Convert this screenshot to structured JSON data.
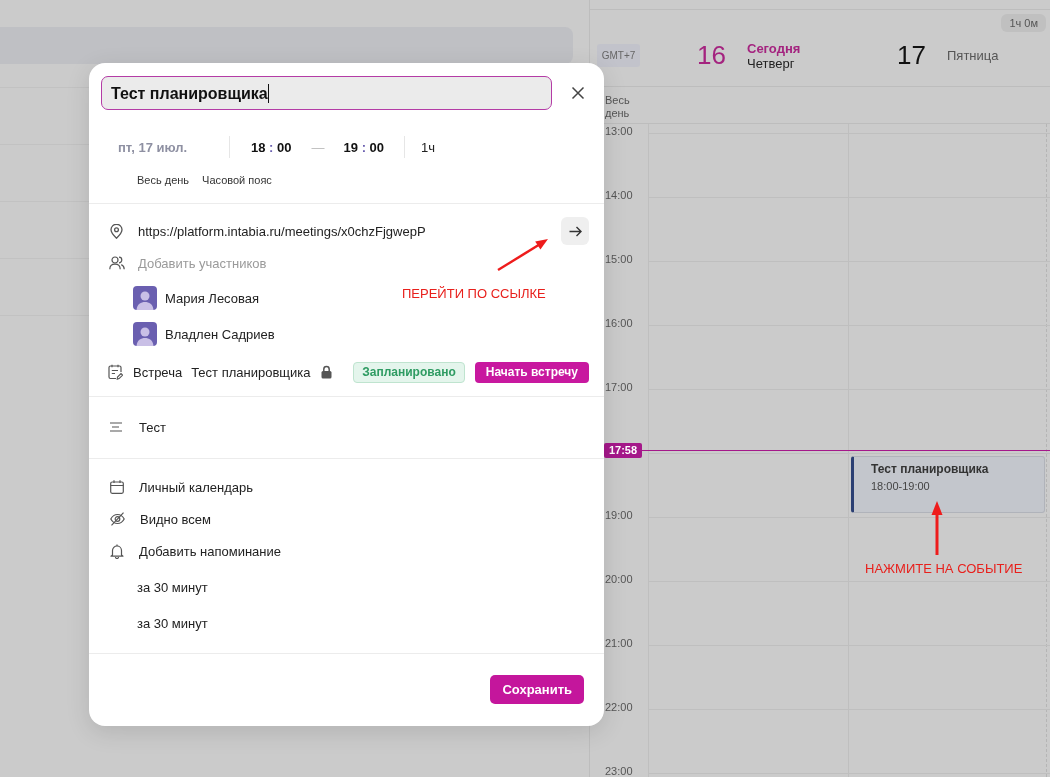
{
  "calendar": {
    "duration_badge": "1ч 0м",
    "timezone": "GMT+7",
    "days": [
      {
        "number": "16",
        "today": true,
        "today_label": "Сегодня",
        "weekday": "Четверг"
      },
      {
        "number": "17",
        "today": false,
        "weekday": "Пятница",
        "events": [
          {
            "title": "Тест планировщика",
            "time": "18:00-19:00"
          }
        ]
      }
    ],
    "all_day_label": "Весь день",
    "hours": [
      {
        "kind": "hour",
        "label": "13:00"
      },
      {
        "kind": "hour",
        "label": "14:00"
      },
      {
        "kind": "hour",
        "label": "15:00"
      },
      {
        "kind": "hour",
        "label": "16:00"
      },
      {
        "kind": "hour",
        "label": "17:00"
      },
      {
        "kind": "now",
        "label": "17:58"
      },
      {
        "kind": "hour",
        "label": "19:00"
      },
      {
        "kind": "hour",
        "label": "20:00"
      },
      {
        "kind": "hour",
        "label": "21:00"
      },
      {
        "kind": "hour",
        "label": "22:00"
      },
      {
        "kind": "hour",
        "label": "23:00"
      }
    ]
  },
  "modal": {
    "title_field": {
      "value": "Тест планировщика"
    },
    "date": "пт, 17 июл.",
    "start_time": {
      "hour": "18",
      "sep": ":",
      "minute": "00"
    },
    "dash": "—",
    "end_time": {
      "hour": "19",
      "sep": ":",
      "minute": "00"
    },
    "duration": "1ч",
    "options": [
      "Весь день",
      "Часовой пояс"
    ],
    "location": {
      "url": "https://platform.intabia.ru/meetings/x0chzFjgwepP"
    },
    "participants": {
      "placeholder": "Добавить участников",
      "people": [
        {
          "name": "Мария Лесовая"
        },
        {
          "name": "Владлен Садриев"
        }
      ]
    },
    "meeting": {
      "label": "Встреча",
      "title": "Тест планировщика",
      "locked": true,
      "status": "Запланировано",
      "start_button": "Начать встречу"
    },
    "description": "Тест",
    "settings": [
      {
        "kind": "calendar",
        "label": "Личный календарь"
      },
      {
        "kind": "visibility",
        "label": "Видно всем"
      },
      {
        "kind": "reminder",
        "label": "Добавить напоминание"
      }
    ],
    "reminders": [
      "за 30 минут",
      "за 30 минут"
    ],
    "save_button": "Сохранить"
  },
  "annotations": [
    {
      "text": "ПЕРЕЙТИ ПО ССЫЛКЕ"
    },
    {
      "text": "НАЖМИТЕ НА СОБЫТИЕ"
    }
  ]
}
